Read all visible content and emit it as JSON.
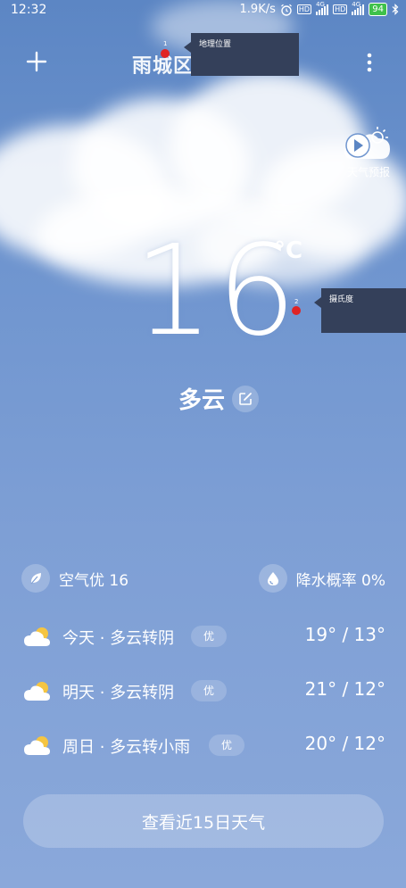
{
  "status_bar": {
    "time": "12:32",
    "net_speed": "1.9K/s",
    "hd1": "HD",
    "sig1": "4G",
    "hd2": "HD",
    "sig2": "4G",
    "battery": "94"
  },
  "header": {
    "location": "雨城区 廣江路",
    "tooltip_location": "地理位置",
    "marker1": "1"
  },
  "forecast_video": {
    "label": "天气预报"
  },
  "current": {
    "temperature": "16",
    "unit": "°C",
    "tooltip_unit": "摄氏度",
    "marker2": "2",
    "condition": "多云"
  },
  "info": {
    "air": "空气优 16",
    "precip": "降水概率 0%"
  },
  "days": [
    {
      "label": "今天 · 多云转阴",
      "aqi": "优",
      "temps": "19° / 13°"
    },
    {
      "label": "明天 · 多云转阴",
      "aqi": "优",
      "temps": "21° / 12°"
    },
    {
      "label": "周日 · 多云转小雨",
      "aqi": "优",
      "temps": "20° / 12°"
    }
  ],
  "button_15day": "查看近15日天气",
  "colors": {
    "sky_top": "#5c86c4",
    "sky_bottom": "#8aa8da",
    "tooltip_bg": "#34405a",
    "marker": "#e02424",
    "battery": "#3fc14a",
    "sun": "#f5c542"
  }
}
